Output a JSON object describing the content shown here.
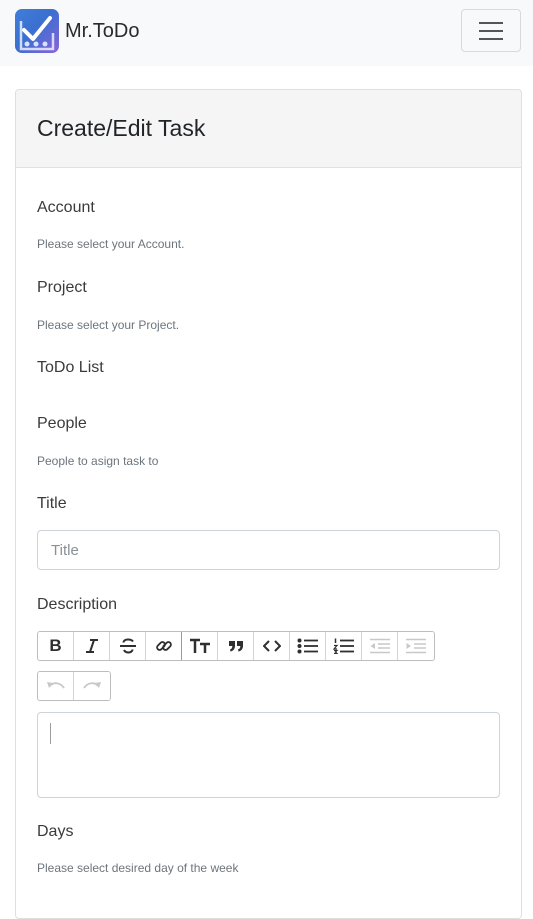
{
  "app": {
    "name": "Mr.ToDo"
  },
  "card": {
    "title": "Create/Edit Task"
  },
  "form": {
    "account": {
      "label": "Account",
      "help": "Please select your Account."
    },
    "project": {
      "label": "Project",
      "help": "Please select your Project."
    },
    "todo_list": {
      "label": "ToDo List"
    },
    "people": {
      "label": "People",
      "help": "People to asign task to"
    },
    "title": {
      "label": "Title",
      "placeholder": "Title",
      "value": ""
    },
    "description": {
      "label": "Description",
      "value": ""
    },
    "days": {
      "label": "Days",
      "help": "Please select desired day of the week"
    }
  },
  "toolbar": {
    "buttons": [
      "bold",
      "italic",
      "strikethrough",
      "link",
      "heading",
      "quote",
      "code",
      "bullet-list",
      "number-list",
      "decrease-indent",
      "increase-indent"
    ],
    "history": [
      "undo",
      "redo"
    ]
  },
  "colors": {
    "navbar_bg": "#f8f9fa",
    "card_header_bg": "#f5f5f5",
    "logo_gradient": [
      "#3f7fd8",
      "#8b63d9"
    ]
  }
}
